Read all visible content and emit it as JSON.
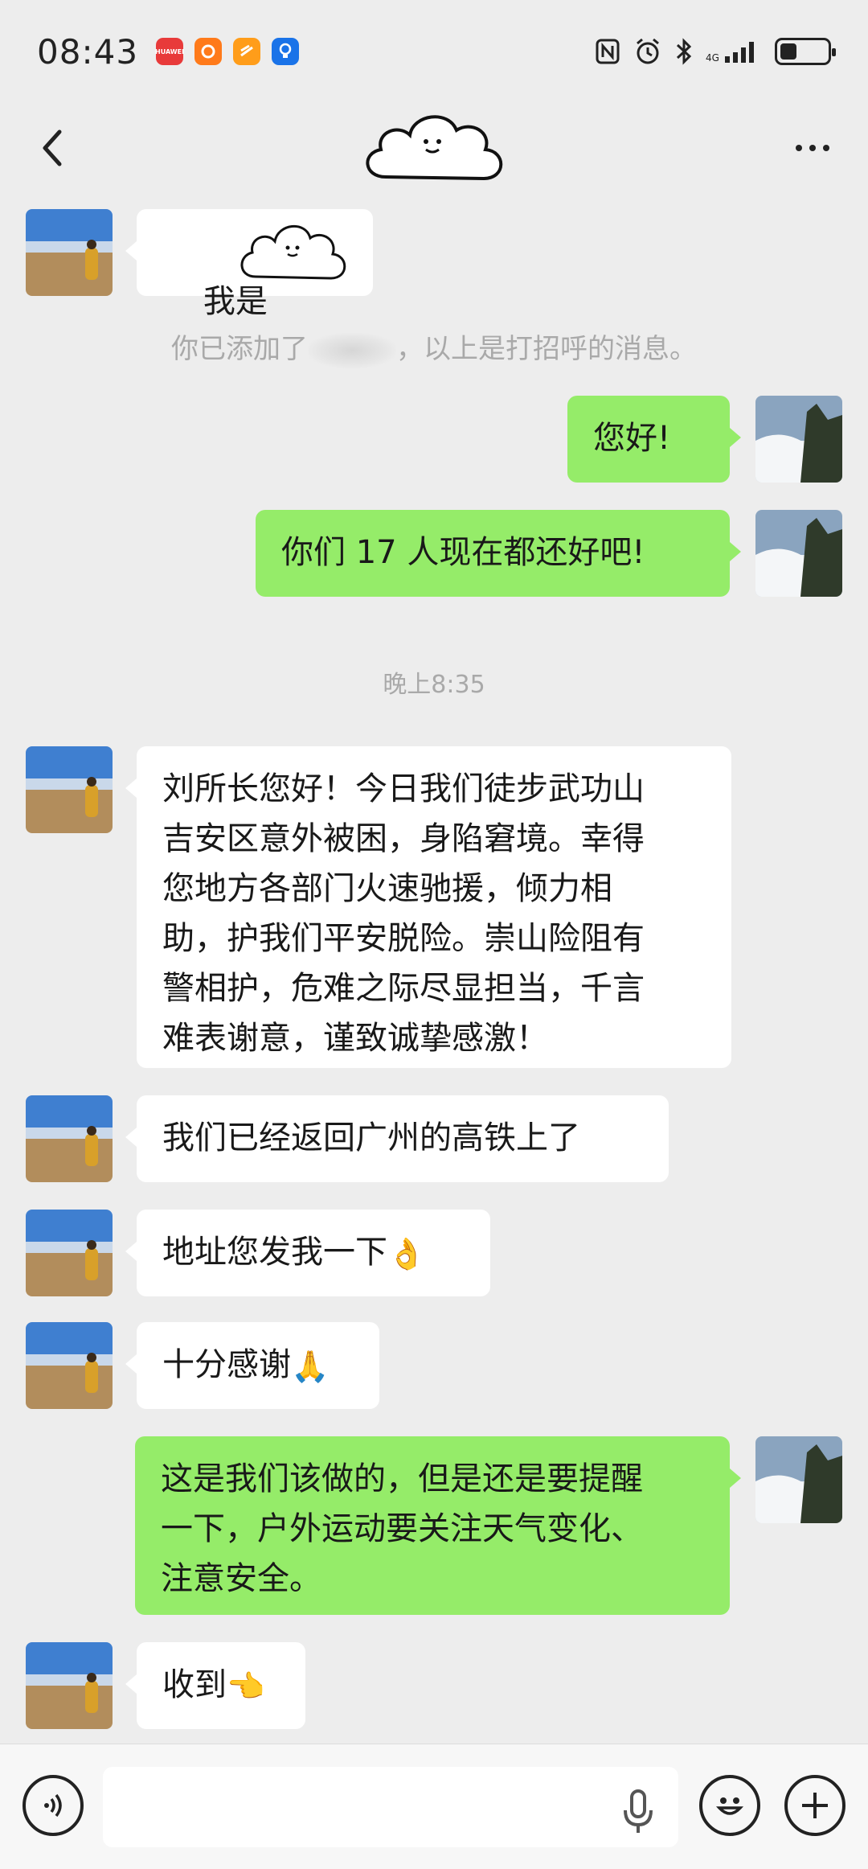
{
  "status": {
    "time": "08:43",
    "apps": [
      {
        "icon": "huawei-appgallery-icon",
        "color": "#e83a3a",
        "label": "HUAWEI"
      },
      {
        "icon": "orange-app-icon",
        "color": "#ff7a1a",
        "label": ""
      },
      {
        "icon": "orange-app-icon-2",
        "color": "#ff9d1a",
        "label": ""
      },
      {
        "icon": "blue-bulb-icon",
        "color": "#1a73e8",
        "label": ""
      }
    ],
    "right_icons": [
      "nfc-icon",
      "alarm-icon",
      "bluetooth-icon",
      "signal-icon"
    ],
    "battery_level": 0.35
  },
  "nav": {
    "back_icon": "back-chevron-icon",
    "more_icon": "more-dots-icon"
  },
  "messages": {
    "m1": {
      "text": "我是"
    },
    "system": {
      "prefix": "你已添加了",
      "suffix": "，以上是打招呼的消息。"
    },
    "m2": {
      "text": "您好!"
    },
    "m3": {
      "text": "你们 17 人现在都还好吧!"
    },
    "time": "晚上8:35",
    "m4": {
      "text": "刘所长您好！今日我们徒步武功山\n吉安区意外被困，身陷窘境。幸得\n您地方各部门火速驰援，倾力相\n助，护我们平安脱险。崇山险阻有\n警相护，危难之际尽显担当，千言\n难表谢意，谨致诚挚感激！"
    },
    "m5": {
      "text": "我们已经返回广州的高铁上了"
    },
    "m6": {
      "text": "地址您发我一下",
      "emoji": "👌"
    },
    "m7": {
      "text": "十分感谢",
      "emoji": "🙏"
    },
    "m8": {
      "text": "这是我们该做的，但是还是要提醒\n一下，户外运动要关注天气变化、\n注意安全。"
    },
    "m9": {
      "text": "收到",
      "emoji": "👈"
    }
  },
  "colors": {
    "bg": "#ededed",
    "my_bubble": "#95ec69",
    "their_bubble": "#ffffff",
    "system_text": "#a9a9a9"
  }
}
